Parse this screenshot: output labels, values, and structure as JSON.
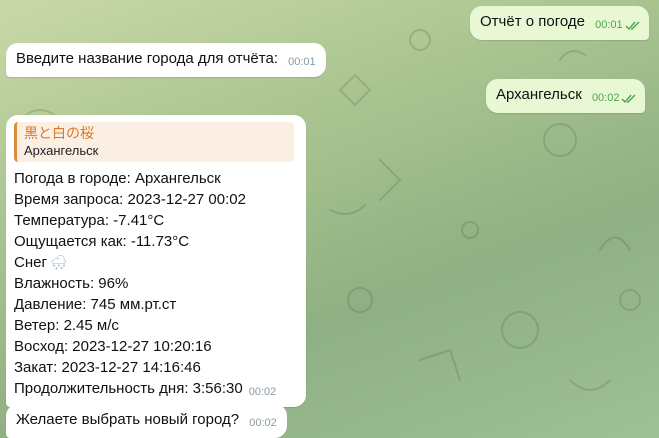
{
  "messages": [
    {
      "side": "out",
      "text": "Отчёт о погоде",
      "time": "00:01"
    },
    {
      "side": "in",
      "text": "Введите название города для отчёта:",
      "time": "00:01"
    },
    {
      "side": "out",
      "text": "Архангельск",
      "time": "00:02"
    }
  ],
  "report": {
    "reply_author": "黒と白の桜",
    "reply_text": "Архангельск",
    "lines": [
      "Погода в городе: Архангельск",
      "Время запроса: 2023-12-27 00:02",
      "Температура: -7.41°C",
      "Ощущается как: -11.73°C",
      "Снег",
      "Влажность: 96%",
      "Давление: 745 мм.рт.ст",
      "Ветер: 2.45 м/с",
      "Восход: 2023-12-27 10:20:16",
      "Закат: 2023-12-27 14:16:46",
      "Продолжительность дня: 3:56:30"
    ],
    "snow_glyph": "🌨",
    "time": "00:02"
  },
  "last": {
    "text": "Желаете выбрать новый город?",
    "time": "00:02"
  },
  "colors": {
    "outgoing": "#e8f8d4",
    "incoming": "#ffffff",
    "reply_accent": "#e08a3c",
    "check": "#4fa34c"
  },
  "icons": {
    "read_receipt": "double-check-icon",
    "snow": "snow-cloud-icon"
  }
}
